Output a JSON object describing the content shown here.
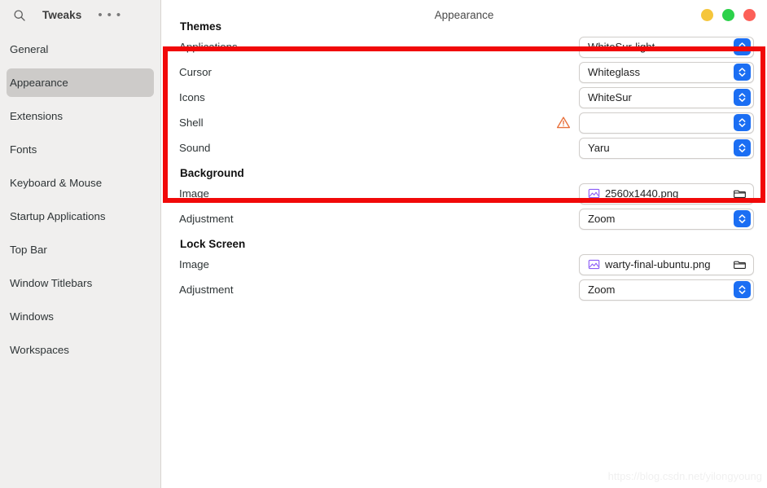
{
  "sidebar": {
    "search_icon": "search-icon",
    "title": "Tweaks",
    "menu_icon": "overflow-menu-icon",
    "items": [
      {
        "label": "General",
        "selected": false
      },
      {
        "label": "Appearance",
        "selected": true
      },
      {
        "label": "Extensions",
        "selected": false
      },
      {
        "label": "Fonts",
        "selected": false
      },
      {
        "label": "Keyboard & Mouse",
        "selected": false
      },
      {
        "label": "Startup Applications",
        "selected": false
      },
      {
        "label": "Top Bar",
        "selected": false
      },
      {
        "label": "Window Titlebars",
        "selected": false
      },
      {
        "label": "Windows",
        "selected": false
      },
      {
        "label": "Workspaces",
        "selected": false
      }
    ]
  },
  "titlebar": {
    "title": "Appearance",
    "buttons": [
      {
        "name": "minimize-button",
        "color": "#f5c63c"
      },
      {
        "name": "maximize-button",
        "color": "#2cd14a"
      },
      {
        "name": "close-button",
        "color": "#fc6058"
      }
    ]
  },
  "sections": {
    "themes": {
      "heading": "Themes",
      "rows": [
        {
          "label": "Applications",
          "value": "WhiteSur-light",
          "warning": false
        },
        {
          "label": "Cursor",
          "value": "Whiteglass",
          "warning": false
        },
        {
          "label": "Icons",
          "value": "WhiteSur",
          "warning": false
        },
        {
          "label": "Shell",
          "value": "",
          "warning": true
        },
        {
          "label": "Sound",
          "value": "Yaru",
          "warning": false
        }
      ]
    },
    "background": {
      "heading": "Background",
      "image_label": "Image",
      "image_value": "2560x1440.png",
      "adjustment_label": "Adjustment",
      "adjustment_value": "Zoom"
    },
    "lock_screen": {
      "heading": "Lock Screen",
      "image_label": "Image",
      "image_value": "warty-final-ubuntu.png",
      "adjustment_label": "Adjustment",
      "adjustment_value": "Zoom"
    }
  },
  "annotation": {
    "name": "red-highlight-rectangle",
    "color": "#f10909"
  },
  "watermark": "https://blog.csdn.net/yilongyoung"
}
